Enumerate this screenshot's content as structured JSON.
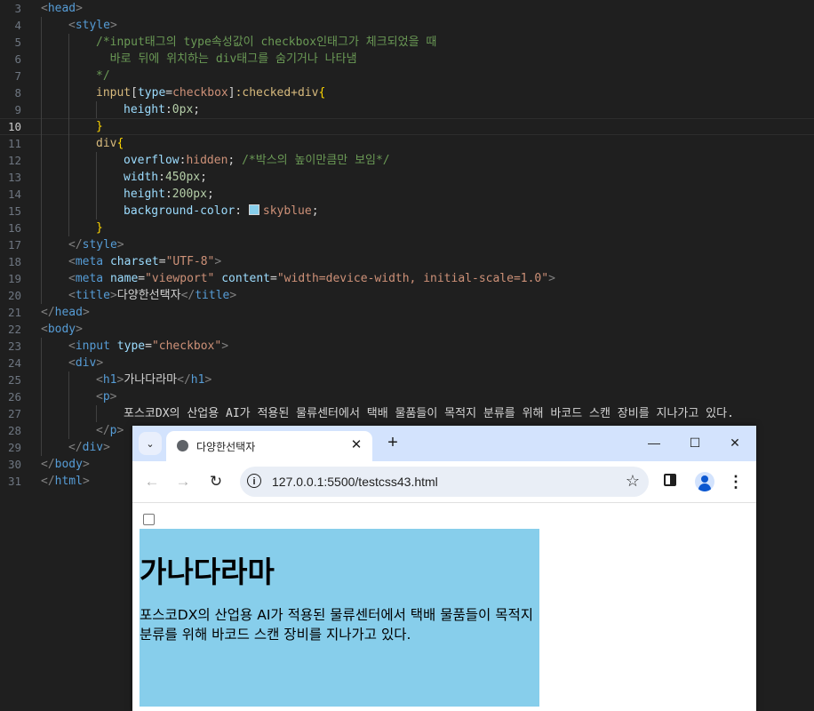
{
  "editor": {
    "lines": [
      {
        "n": "3",
        "indent": 0,
        "parts": [
          {
            "c": "br",
            "t": "<"
          },
          {
            "c": "tag",
            "t": "head"
          },
          {
            "c": "br",
            "t": ">"
          }
        ]
      },
      {
        "n": "4",
        "indent": 1,
        "parts": [
          {
            "c": "br",
            "t": "<"
          },
          {
            "c": "tag",
            "t": "style"
          },
          {
            "c": "br",
            "t": ">"
          }
        ]
      },
      {
        "n": "5",
        "indent": 2,
        "parts": [
          {
            "c": "cmt",
            "t": "/*input태그의 type속성값이 checkbox인태그가 체크되었을 때"
          }
        ]
      },
      {
        "n": "6",
        "indent": 2,
        "parts": [
          {
            "c": "cmt",
            "t": "  바로 뒤에 위치하는 div태그를 숨기거나 나타냄"
          }
        ]
      },
      {
        "n": "7",
        "indent": 2,
        "parts": [
          {
            "c": "cmt",
            "t": "*/"
          }
        ]
      },
      {
        "n": "8",
        "indent": 2,
        "parts": [
          {
            "c": "sel",
            "t": "input"
          },
          {
            "c": "txt",
            "t": "["
          },
          {
            "c": "attr",
            "t": "type"
          },
          {
            "c": "txt",
            "t": "="
          },
          {
            "c": "val",
            "t": "checkbox"
          },
          {
            "c": "txt",
            "t": "]"
          },
          {
            "c": "sel",
            "t": ":checked+div"
          },
          {
            "c": "brace",
            "t": "{"
          }
        ]
      },
      {
        "n": "9",
        "indent": 3,
        "parts": [
          {
            "c": "prop",
            "t": "height"
          },
          {
            "c": "txt",
            "t": ":"
          },
          {
            "c": "num",
            "t": "0px"
          },
          {
            "c": "txt",
            "t": ";"
          }
        ]
      },
      {
        "n": "10",
        "indent": 2,
        "current": true,
        "parts": [
          {
            "c": "brace",
            "t": "}"
          }
        ]
      },
      {
        "n": "11",
        "indent": 2,
        "parts": [
          {
            "c": "sel",
            "t": "div"
          },
          {
            "c": "brace",
            "t": "{"
          }
        ]
      },
      {
        "n": "12",
        "indent": 3,
        "parts": [
          {
            "c": "prop",
            "t": "overflow"
          },
          {
            "c": "txt",
            "t": ":"
          },
          {
            "c": "val",
            "t": "hidden"
          },
          {
            "c": "txt",
            "t": "; "
          },
          {
            "c": "cmt",
            "t": "/*박스의 높이만큼만 보임*/"
          }
        ]
      },
      {
        "n": "13",
        "indent": 3,
        "parts": [
          {
            "c": "prop",
            "t": "width"
          },
          {
            "c": "txt",
            "t": ":"
          },
          {
            "c": "num",
            "t": "450px"
          },
          {
            "c": "txt",
            "t": ";"
          }
        ]
      },
      {
        "n": "14",
        "indent": 3,
        "parts": [
          {
            "c": "prop",
            "t": "height"
          },
          {
            "c": "txt",
            "t": ":"
          },
          {
            "c": "num",
            "t": "200px"
          },
          {
            "c": "txt",
            "t": ";"
          }
        ]
      },
      {
        "n": "15",
        "indent": 3,
        "swatch": true,
        "parts": [
          {
            "c": "prop",
            "t": "background-color"
          },
          {
            "c": "txt",
            "t": ": "
          },
          {
            "c": "val",
            "t": "skyblue"
          },
          {
            "c": "txt",
            "t": ";"
          }
        ]
      },
      {
        "n": "16",
        "indent": 2,
        "parts": [
          {
            "c": "brace",
            "t": "}"
          }
        ]
      },
      {
        "n": "17",
        "indent": 1,
        "parts": [
          {
            "c": "br",
            "t": "</"
          },
          {
            "c": "tag",
            "t": "style"
          },
          {
            "c": "br",
            "t": ">"
          }
        ]
      },
      {
        "n": "18",
        "indent": 1,
        "parts": [
          {
            "c": "br",
            "t": "<"
          },
          {
            "c": "tag",
            "t": "meta"
          },
          {
            "c": "txt",
            "t": " "
          },
          {
            "c": "attr",
            "t": "charset"
          },
          {
            "c": "txt",
            "t": "="
          },
          {
            "c": "str",
            "t": "\"UTF-8\""
          },
          {
            "c": "br",
            "t": ">"
          }
        ]
      },
      {
        "n": "19",
        "indent": 1,
        "parts": [
          {
            "c": "br",
            "t": "<"
          },
          {
            "c": "tag",
            "t": "meta"
          },
          {
            "c": "txt",
            "t": " "
          },
          {
            "c": "attr",
            "t": "name"
          },
          {
            "c": "txt",
            "t": "="
          },
          {
            "c": "str",
            "t": "\"viewport\""
          },
          {
            "c": "txt",
            "t": " "
          },
          {
            "c": "attr",
            "t": "content"
          },
          {
            "c": "txt",
            "t": "="
          },
          {
            "c": "str",
            "t": "\"width=device-width, initial-scale=1.0\""
          },
          {
            "c": "br",
            "t": ">"
          }
        ]
      },
      {
        "n": "20",
        "indent": 1,
        "parts": [
          {
            "c": "br",
            "t": "<"
          },
          {
            "c": "tag",
            "t": "title"
          },
          {
            "c": "br",
            "t": ">"
          },
          {
            "c": "txt",
            "t": "다양한선택자"
          },
          {
            "c": "br",
            "t": "</"
          },
          {
            "c": "tag",
            "t": "title"
          },
          {
            "c": "br",
            "t": ">"
          }
        ]
      },
      {
        "n": "21",
        "indent": 0,
        "parts": [
          {
            "c": "br",
            "t": "</"
          },
          {
            "c": "tag",
            "t": "head"
          },
          {
            "c": "br",
            "t": ">"
          }
        ]
      },
      {
        "n": "22",
        "indent": 0,
        "parts": [
          {
            "c": "br",
            "t": "<"
          },
          {
            "c": "tag",
            "t": "body"
          },
          {
            "c": "br",
            "t": ">"
          }
        ]
      },
      {
        "n": "23",
        "indent": 1,
        "parts": [
          {
            "c": "br",
            "t": "<"
          },
          {
            "c": "tag",
            "t": "input"
          },
          {
            "c": "txt",
            "t": " "
          },
          {
            "c": "attr",
            "t": "type"
          },
          {
            "c": "txt",
            "t": "="
          },
          {
            "c": "str",
            "t": "\"checkbox\""
          },
          {
            "c": "br",
            "t": ">"
          }
        ]
      },
      {
        "n": "24",
        "indent": 1,
        "parts": [
          {
            "c": "br",
            "t": "<"
          },
          {
            "c": "tag",
            "t": "div"
          },
          {
            "c": "br",
            "t": ">"
          }
        ]
      },
      {
        "n": "25",
        "indent": 2,
        "parts": [
          {
            "c": "br",
            "t": "<"
          },
          {
            "c": "tag",
            "t": "h1"
          },
          {
            "c": "br",
            "t": ">"
          },
          {
            "c": "txt",
            "t": "가나다라마"
          },
          {
            "c": "br",
            "t": "</"
          },
          {
            "c": "tag",
            "t": "h1"
          },
          {
            "c": "br",
            "t": ">"
          }
        ]
      },
      {
        "n": "26",
        "indent": 2,
        "parts": [
          {
            "c": "br",
            "t": "<"
          },
          {
            "c": "tag",
            "t": "p"
          },
          {
            "c": "br",
            "t": ">"
          }
        ]
      },
      {
        "n": "27",
        "indent": 3,
        "parts": [
          {
            "c": "txt",
            "t": "포스코DX의 산업용 AI가 적용된 물류센터에서 택배 물품들이 목적지 분류를 위해 바코드 스캔 장비를 지나가고 있다."
          }
        ]
      },
      {
        "n": "28",
        "indent": 2,
        "parts": [
          {
            "c": "br",
            "t": "</"
          },
          {
            "c": "tag",
            "t": "p"
          },
          {
            "c": "br",
            "t": ">"
          }
        ]
      },
      {
        "n": "29",
        "indent": 1,
        "parts": [
          {
            "c": "br",
            "t": "</"
          },
          {
            "c": "tag",
            "t": "div"
          },
          {
            "c": "br",
            "t": ">"
          }
        ]
      },
      {
        "n": "30",
        "indent": 0,
        "parts": [
          {
            "c": "br",
            "t": "</"
          },
          {
            "c": "tag",
            "t": "body"
          },
          {
            "c": "br",
            "t": ">"
          }
        ]
      },
      {
        "n": "31",
        "indent": 0,
        "parts": [
          {
            "c": "br",
            "t": "</"
          },
          {
            "c": "tag",
            "t": "html"
          },
          {
            "c": "br",
            "t": ">"
          }
        ]
      }
    ]
  },
  "browser": {
    "tab_title": "다양한선택자",
    "tab_close": "✕",
    "new_tab": "+",
    "tab_search": "⌄",
    "minimize": "—",
    "maximize": "☐",
    "close": "✕",
    "back": "←",
    "forward": "→",
    "reload": "↻",
    "url": "127.0.0.1:5500/testcss43.html",
    "bookmark": "☆",
    "menu": "⋮",
    "info": "i"
  },
  "page": {
    "heading": "가나다라마",
    "paragraph": "포스코DX의 산업용 AI가 적용된 물류센터에서 택배 물품들이 목적지 분류를 위해 바코드 스캔 장비를 지나가고 있다.",
    "checkbox_checked": false,
    "box_color": "#87ceeb"
  },
  "colors": {
    "editor_bg": "#1f1f1f",
    "tabstrip_bg": "#d3e3fd",
    "skyblue": "#87ceeb"
  }
}
